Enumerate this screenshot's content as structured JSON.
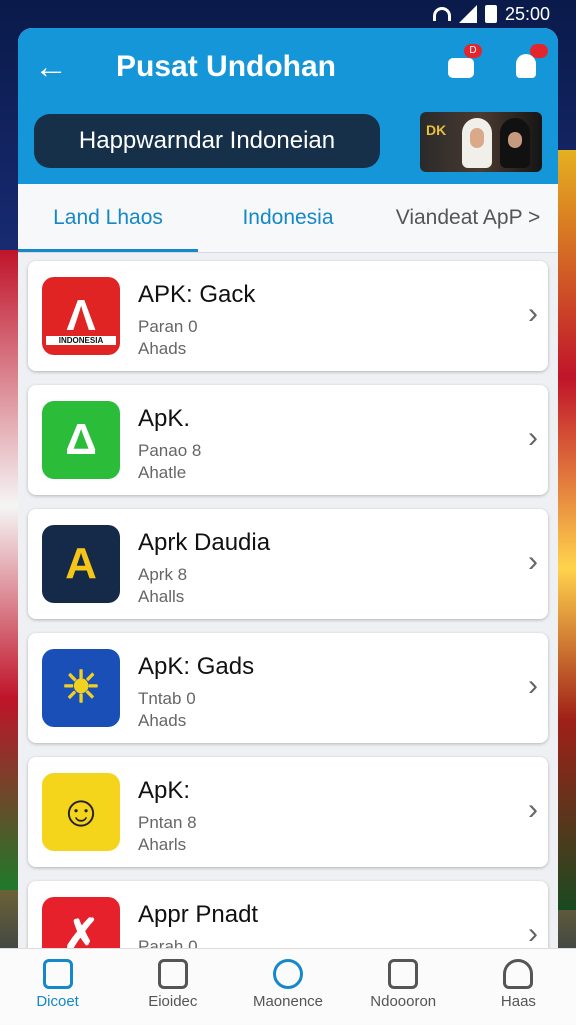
{
  "statusbar": {
    "time": "25:00"
  },
  "header": {
    "back_icon": "arrow-left-icon",
    "title": "Pusat Undohan",
    "message_badge": "D",
    "banner_text": "Happwarndar Indoneian",
    "thumb_text": "DK"
  },
  "tabs": [
    {
      "label": "Land Lhaos",
      "active": true
    },
    {
      "label": "Indonesia",
      "active": false
    },
    {
      "label": "Viandeat ApP >",
      "active": false
    }
  ],
  "apps": [
    {
      "name": "APK: Gack",
      "line1": "Paran  0",
      "line2": "Ahads",
      "icon": "red-a-logo-icon",
      "icon_sub": "INDONESIA"
    },
    {
      "name": "ApK.",
      "line1": "Panao  8",
      "line2": "Ahatle",
      "icon": "green-bell-icon"
    },
    {
      "name": "Aprk Daudia",
      "line1": "Aprk  8",
      "line2": "Ahalls",
      "icon": "dark-a-logo-icon"
    },
    {
      "name": "ApK: Gads",
      "line1": "Tntab  0",
      "line2": "Ahads",
      "icon": "blue-sun-icon"
    },
    {
      "name": "ApK:",
      "line1": "Pntan  8",
      "line2": "Aharls",
      "icon": "yellow-face-icon"
    },
    {
      "name": "Appr Pnadt",
      "line1": "Parah  0",
      "line2": "",
      "icon": "red-x-logo-icon"
    }
  ],
  "bottomnav": [
    {
      "label": "Dicoet",
      "active": true,
      "icon": "home-icon"
    },
    {
      "label": "Eioidec",
      "active": false,
      "icon": "gallery-icon"
    },
    {
      "label": "Maonence",
      "active": false,
      "icon": "search-icon"
    },
    {
      "label": "Ndoooron",
      "active": false,
      "icon": "devices-icon"
    },
    {
      "label": "Haas",
      "active": false,
      "icon": "person-icon"
    }
  ]
}
